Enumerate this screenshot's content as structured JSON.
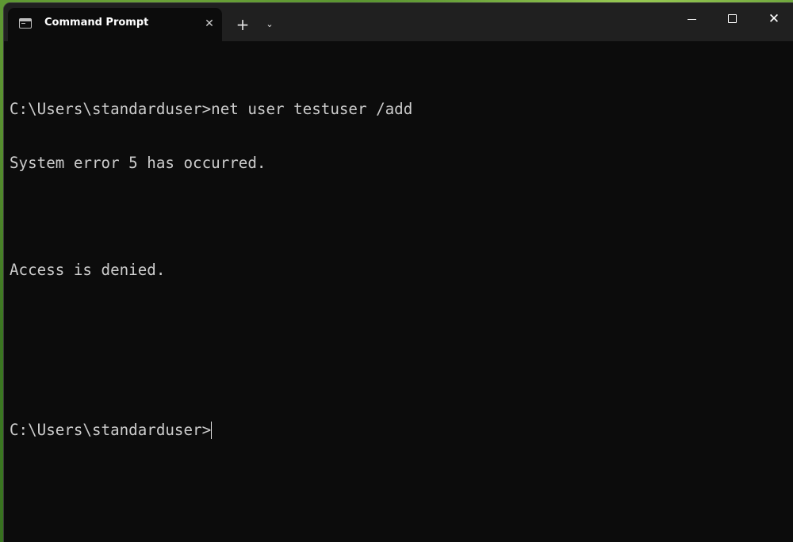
{
  "window": {
    "tab_title": "Command Prompt",
    "tab_icon": "terminal-icon",
    "tab_close_icon": "close-icon",
    "new_tab_icon": "plus-icon",
    "dropdown_icon": "chevron-down-icon",
    "caption": {
      "minimize_icon": "minimize-icon",
      "maximize_icon": "maximize-icon",
      "close_icon": "close-icon"
    }
  },
  "terminal": {
    "lines": [
      "C:\\Users\\standarduser>net user testuser /add",
      "System error 5 has occurred.",
      "",
      "Access is denied.",
      "",
      "",
      "C:\\Users\\standarduser>"
    ]
  },
  "colors": {
    "background": "#0c0c0c",
    "titlebar": "#202020",
    "text": "#cccccc"
  }
}
